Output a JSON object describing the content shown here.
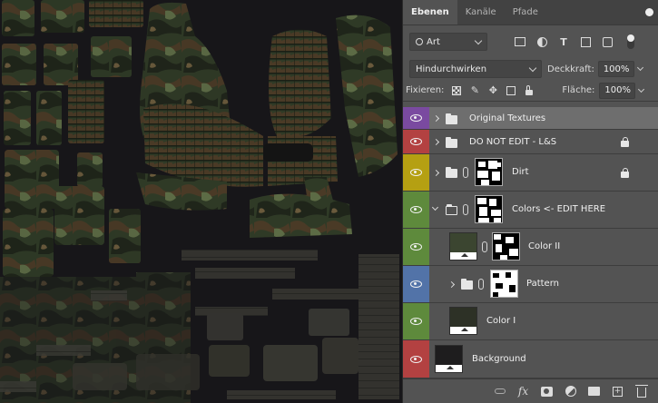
{
  "panel": {
    "tabs": [
      {
        "label": "Ebenen"
      },
      {
        "label": "Kanäle"
      },
      {
        "label": "Pfade"
      }
    ],
    "filter": {
      "kind": "Art"
    },
    "blend_mode": "Hindurchwirken",
    "opacity_label": "Deckkraft:",
    "opacity_value": "100%",
    "lock_label": "Fixieren:",
    "fill_label": "Fläche:",
    "fill_value": "100%"
  },
  "layers": [
    {
      "name": "Original Textures",
      "tag_color": "#7a4aa0",
      "type": "group",
      "selected": true
    },
    {
      "name": "DO NOT EDIT  - L&S",
      "tag_color": "#b34141",
      "type": "group",
      "locked": true
    },
    {
      "name": "Dirt",
      "tag_color": "#b5a012",
      "type": "group-mask",
      "locked": true
    },
    {
      "name": "Colors <- EDIT HERE",
      "tag_color": "#5e8a3c",
      "type": "group-mask",
      "expanded": true
    },
    {
      "name": "Color II",
      "tag_color": "#5e8a3c",
      "type": "fill-mask",
      "fill": "#3b4530"
    },
    {
      "name": "Pattern",
      "tag_color": "#5273a8",
      "type": "group-mask"
    },
    {
      "name": "Color I",
      "tag_color": "#5e8a3c",
      "type": "fill",
      "fill": "#2d3126"
    },
    {
      "name": "Background",
      "tag_color": "#b34141",
      "type": "fill",
      "fill": "#1e1d1e"
    }
  ],
  "colors": {
    "panel_bg": "#535353",
    "selected_layer": "#6e6e6e",
    "canvas_bg": "#171619"
  }
}
